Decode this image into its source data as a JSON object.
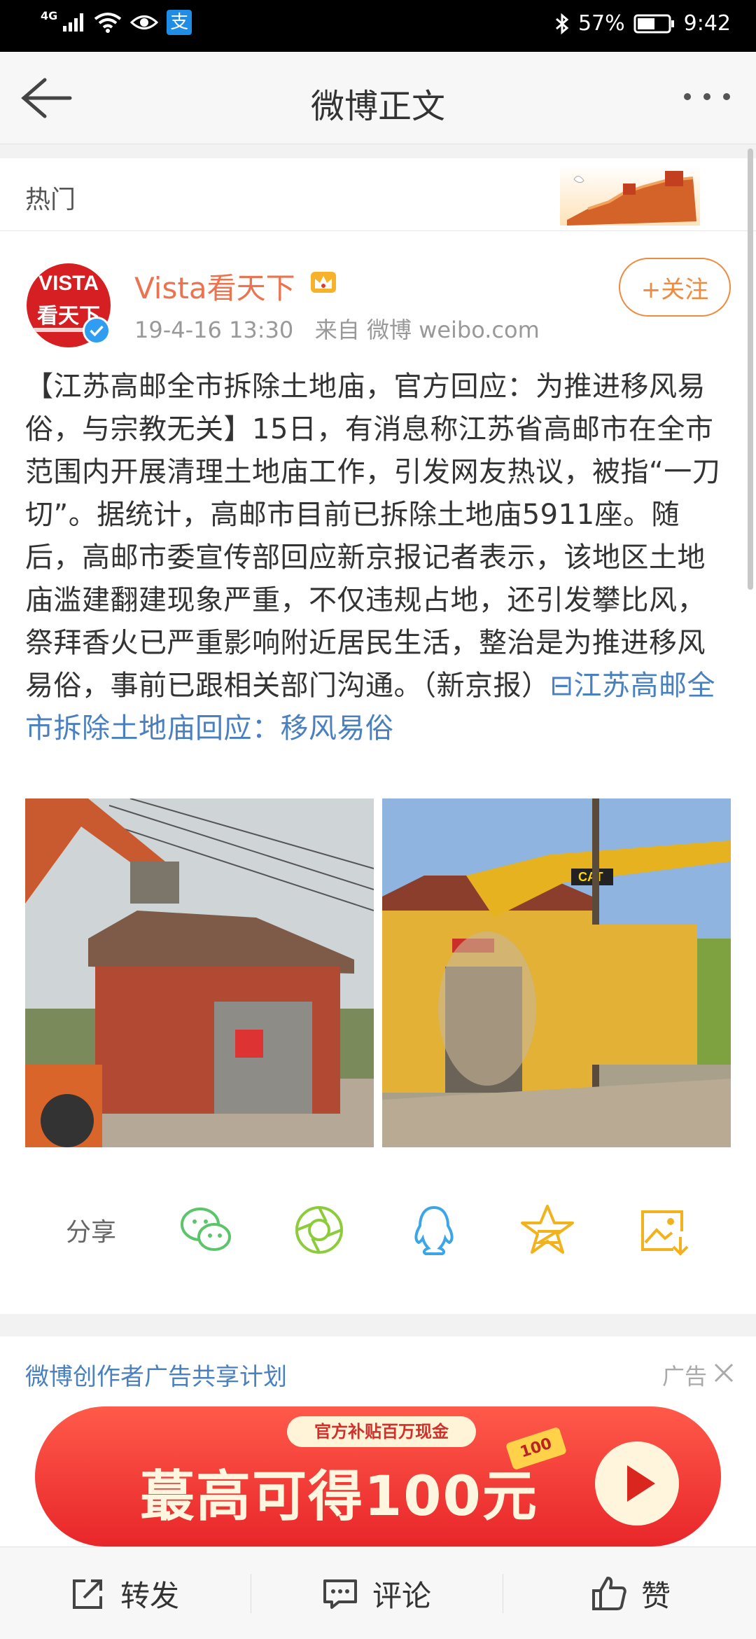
{
  "status_bar": {
    "network": "4G",
    "battery": "57%",
    "time": "9:42",
    "alipay_icon": "支"
  },
  "nav": {
    "title": "微博正文"
  },
  "section": {
    "label": "热门"
  },
  "post": {
    "avatar_line1": "VISTA",
    "avatar_line2": "看天下",
    "username": "Vista看天下",
    "timestamp": "19-4-16 13:30",
    "source": "来自 微博 weibo.com",
    "follow_label": "+关注",
    "text": "【江苏高邮全市拆除土地庙，官方回应：为推进移风易俗，与宗教无关】15日，有消息称江苏省高邮市在全市范围内开展清理土地庙工作，引发网友热议，被指“一刀切”。据统计，高邮市目前已拆除土地庙5911座。随后，高邮市委宣传部回应新京报记者表示，该地区土地庙滥建翻建现象严重，不仅违规占地，还引发攀比风，祭拜香火已严重影响附近居民生活，整治是为推进移风易俗，事前已跟相关部门沟通。（新京报）",
    "link_icon": "⊟",
    "link_text": "江苏高邮全市拆除土地庙回应：移风易俗",
    "photo2_brand": "CAT"
  },
  "share": {
    "label": "分享",
    "icons": [
      "wechat-icon",
      "moments-icon",
      "qq-icon",
      "qzone-icon",
      "save-image-icon"
    ]
  },
  "ad": {
    "title": "微博创作者广告共享计划",
    "tag": "广告",
    "pill": "官方补贴百万现金",
    "headline": "蕞高可得100元",
    "coin": "100"
  },
  "toolbar": {
    "repost": "转发",
    "comment": "评论",
    "like": "赞"
  },
  "colors": {
    "accent_orange": "#eb7350",
    "link_blue": "#4a80c0",
    "follow_orange": "#f08a3e"
  }
}
